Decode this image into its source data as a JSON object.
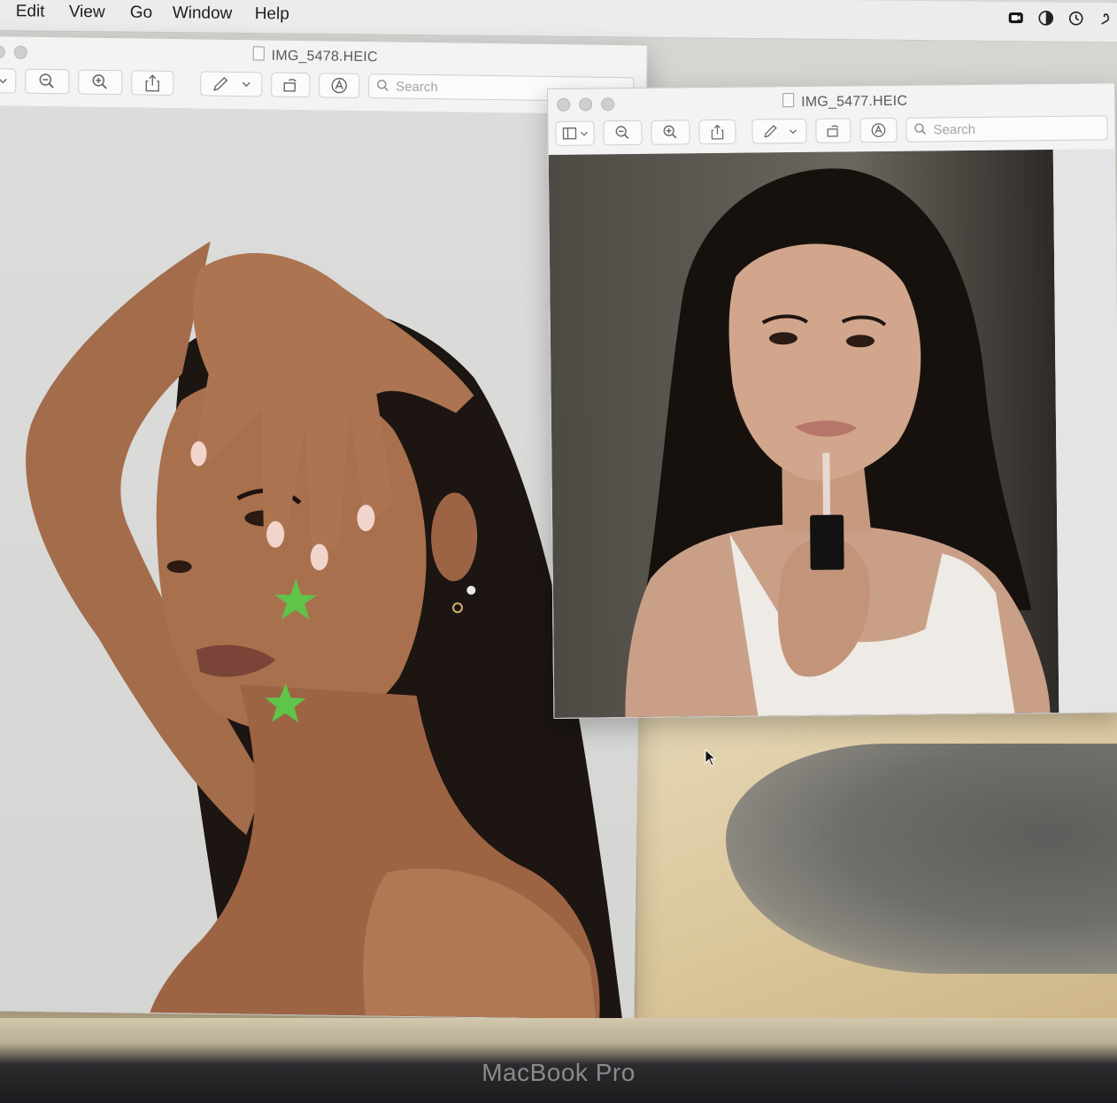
{
  "menubar": {
    "items": [
      "Edit",
      "View",
      "Go",
      "Window",
      "Help"
    ],
    "status_icons": [
      "facetime-camera-icon",
      "screen-time-icon",
      "time-machine-icon",
      "script-icon"
    ]
  },
  "window_back": {
    "title": "IMG_5478.HEIC",
    "search_placeholder": "Search",
    "photo": "woman-with-green-star-stickers"
  },
  "window_front": {
    "title": "IMG_5477.HEIC",
    "search_placeholder": "Search",
    "photo": "woman-applying-lip-gloss"
  },
  "device": {
    "brand": "MacBook Pro"
  },
  "colors": {
    "menubar": "#ececec",
    "window": "#f3f3f3",
    "accent_star": "#5ec44a"
  }
}
